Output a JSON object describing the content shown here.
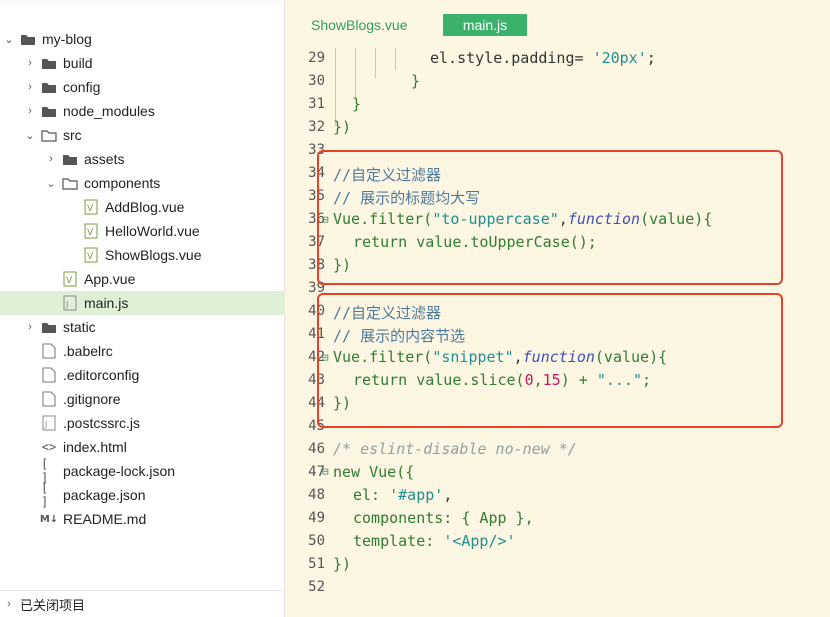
{
  "project": {
    "root": "my-blog",
    "items": [
      {
        "label": "build",
        "type": "folder",
        "arrow": "›"
      },
      {
        "label": "config",
        "type": "folder",
        "arrow": "›"
      },
      {
        "label": "node_modules",
        "type": "folder",
        "arrow": "›"
      },
      {
        "label": "src",
        "type": "folder",
        "arrow": "⌄"
      },
      {
        "label": "assets",
        "type": "folder",
        "arrow": "›"
      },
      {
        "label": "components",
        "type": "folder",
        "arrow": "⌄"
      },
      {
        "label": "AddBlog.vue",
        "type": "vue"
      },
      {
        "label": "HelloWorld.vue",
        "type": "vue"
      },
      {
        "label": "ShowBlogs.vue",
        "type": "vue"
      },
      {
        "label": "App.vue",
        "type": "vue"
      },
      {
        "label": "main.js",
        "type": "js",
        "selected": true
      },
      {
        "label": "static",
        "type": "folder",
        "arrow": "›"
      },
      {
        "label": ".babelrc",
        "type": "file"
      },
      {
        "label": ".editorconfig",
        "type": "file"
      },
      {
        "label": ".gitignore",
        "type": "file"
      },
      {
        "label": ".postcssrc.js",
        "type": "js"
      },
      {
        "label": "index.html",
        "type": "html"
      },
      {
        "label": "package-lock.json",
        "type": "json"
      },
      {
        "label": "package.json",
        "type": "json"
      },
      {
        "label": "README.md",
        "type": "md"
      }
    ],
    "closed_projects_label": "已关闭项目"
  },
  "tabs": [
    {
      "label": "ShowBlogs.vue",
      "active": false
    },
    {
      "label": "main.js",
      "active": true
    }
  ],
  "editor": {
    "line_numbers": [
      "29",
      "30",
      "31",
      "32",
      "33",
      "34",
      "35",
      "36",
      "37",
      "38",
      "39",
      "40",
      "41",
      "42",
      "43",
      "44",
      "45",
      "46",
      "47",
      "48",
      "49",
      "50",
      "51",
      "52"
    ],
    "lines": {
      "l29_a": "el.style.padding= ",
      "l29_b": "'20px'",
      "l29_c": ";",
      "l30": "}",
      "l31": "}",
      "l32": "})",
      "l34": "//自定义过滤器",
      "l35": "// 展示的标题均大写",
      "l36_a": "Vue.filter(",
      "l36_b": "\"to-uppercase\"",
      "l36_c": ",",
      "l36_d": "function",
      "l36_e": "(value){",
      "l37_a": "return",
      "l37_b": " value.toUpperCase();",
      "l38": "})",
      "l40": "//自定义过滤器",
      "l41": "// 展示的内容节选",
      "l42_a": "Vue.filter(",
      "l42_b": "\"snippet\"",
      "l42_c": ",",
      "l42_d": "function",
      "l42_e": "(value){",
      "l43_a": "return",
      "l43_b": " value.slice(",
      "l43_c": "0",
      "l43_d": ",",
      "l43_e": "15",
      "l43_f": ") + ",
      "l43_g": "\"...\"",
      "l43_h": ";",
      "l44": "})",
      "l46": "/* eslint-disable no-new */",
      "l47_a": "new",
      "l47_b": " Vue({",
      "l48_a": "el: ",
      "l48_b": "'#app'",
      "l48_c": ",",
      "l49": "components: { App },",
      "l50_a": "template: ",
      "l50_b": "'<App/>'",
      "l51": "})"
    }
  },
  "colors": {
    "editor_bg": "#fdf6e3",
    "highlight_box": "#e0442a",
    "active_tab": "#3bb26b",
    "selected_file": "#dff0d8"
  }
}
